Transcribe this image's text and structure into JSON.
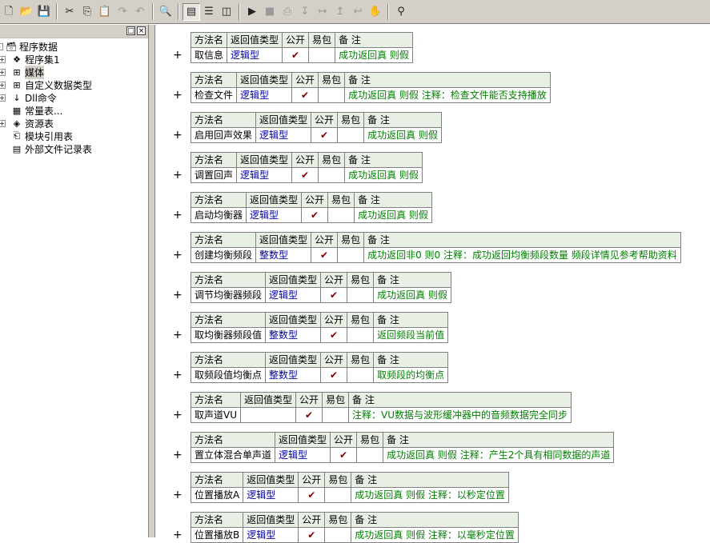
{
  "toolbar": {
    "buttons": [
      {
        "icon": "new-file-icon",
        "glyph": "🗋"
      },
      {
        "icon": "open-folder-icon",
        "glyph": "📂"
      },
      {
        "icon": "save-icon",
        "glyph": "💾"
      },
      {
        "sep": true
      },
      {
        "icon": "cut-icon",
        "glyph": "✂"
      },
      {
        "icon": "copy-icon",
        "glyph": "⎘"
      },
      {
        "icon": "paste-icon",
        "glyph": "📋"
      },
      {
        "icon": "redo-icon",
        "glyph": "↷",
        "disabled": true
      },
      {
        "icon": "undo-icon",
        "glyph": "↶",
        "disabled": true
      },
      {
        "sep": true
      },
      {
        "icon": "find-icon",
        "glyph": "🔍"
      },
      {
        "sep": true
      },
      {
        "icon": "layout-view-icon",
        "glyph": "▤",
        "pressed": true
      },
      {
        "icon": "split-horizontal-icon",
        "glyph": "☰"
      },
      {
        "icon": "split-vertical-icon",
        "glyph": "◫"
      },
      {
        "sep": true
      },
      {
        "icon": "run-icon",
        "glyph": "▶"
      },
      {
        "icon": "stop-icon",
        "glyph": "■",
        "disabled": true
      },
      {
        "icon": "step-compile-icon",
        "glyph": "⎙",
        "disabled": true
      },
      {
        "icon": "step-into-icon",
        "glyph": "↧",
        "disabled": true
      },
      {
        "icon": "step-over-icon",
        "glyph": "↦",
        "disabled": true
      },
      {
        "icon": "step-out-icon",
        "glyph": "↥",
        "disabled": true
      },
      {
        "icon": "run-to-cursor-icon",
        "glyph": "↩",
        "disabled": true
      },
      {
        "icon": "breakpoint-hand-icon",
        "glyph": "✋",
        "disabled": true
      },
      {
        "sep": true
      },
      {
        "icon": "binoculars-icon",
        "glyph": "⚲"
      }
    ]
  },
  "panel": {
    "pin_glyph": "□",
    "close_glyph": "×"
  },
  "tree": [
    {
      "label": "程序数据",
      "icon": "program-data-icon",
      "glyph": "🗃",
      "indent": 0,
      "box": "-"
    },
    {
      "label": "程序集1",
      "icon": "assembly-icon",
      "glyph": "❖",
      "indent": 1,
      "box": "+"
    },
    {
      "label": "媒体",
      "icon": "class-icon",
      "glyph": "⊞",
      "indent": 1,
      "box": "+",
      "selected": true
    },
    {
      "label": "自定义数据类型",
      "icon": "custom-type-icon",
      "glyph": "⊞",
      "indent": 1,
      "box": "+"
    },
    {
      "label": "Dll命令",
      "icon": "dll-command-icon",
      "glyph": "↓",
      "indent": 1,
      "box": "+"
    },
    {
      "label": "常量表...",
      "icon": "constant-table-icon",
      "glyph": "▦",
      "indent": 1,
      "box": ""
    },
    {
      "label": "资源表",
      "icon": "resource-table-icon",
      "glyph": "◈",
      "indent": 1,
      "box": "+"
    },
    {
      "label": "模块引用表",
      "icon": "module-ref-icon",
      "glyph": "⎗",
      "indent": 1,
      "box": ""
    },
    {
      "label": "外部文件记录表",
      "icon": "external-file-icon",
      "glyph": "▤",
      "indent": 1,
      "box": ""
    }
  ],
  "method_headers": {
    "name": "方法名",
    "return_type": "返回值类型",
    "public": "公开",
    "easy_pkg": "易包",
    "remark": "备 注"
  },
  "plus_glyph": "+",
  "check_glyph": "✔",
  "methods": [
    {
      "name": "取信息",
      "return_type": "逻辑型",
      "public": true,
      "remark": "成功返回真  则假"
    },
    {
      "name": "检查文件",
      "return_type": "逻辑型",
      "public": true,
      "remark": "成功返回真 则假  注释：检查文件能否支持播放"
    },
    {
      "name": "启用回声效果",
      "return_type": "逻辑型",
      "public": true,
      "remark": "成功返回真  则假"
    },
    {
      "name": "调置回声",
      "return_type": "逻辑型",
      "public": true,
      "remark": "成功返回真  则假"
    },
    {
      "name": "启动均衡器",
      "return_type": "逻辑型",
      "public": true,
      "remark": "成功返回真  则假"
    },
    {
      "name": "创建均衡频段",
      "return_type": "整数型",
      "public": true,
      "remark": "成功返回非0 则0  注释：成功返回均衡频段数量 频段详情见参考帮助资料"
    },
    {
      "name": "调节均衡器频段",
      "return_type": "逻辑型",
      "public": true,
      "remark": "成功返回真  则假"
    },
    {
      "name": "取均衡器频段值",
      "return_type": "整数型",
      "public": true,
      "remark": "返回频段当前值"
    },
    {
      "name": "取频段值均衡点",
      "return_type": "整数型",
      "public": true,
      "remark": "取频段的均衡点"
    },
    {
      "name": "取声道VU",
      "return_type": "",
      "public": true,
      "remark": "注释：VU数据与波形缓冲器中的音频数据完全同步"
    },
    {
      "name": "置立体混合单声道",
      "return_type": "逻辑型",
      "public": true,
      "remark": "成功返回真  则假  注释：产生2个具有相同数据的声道"
    },
    {
      "name": "位置播放A",
      "return_type": "逻辑型",
      "public": true,
      "remark": "成功返回真 则假   注释：以秒定位置"
    },
    {
      "name": "位置播放B",
      "return_type": "逻辑型",
      "public": true,
      "remark": "成功返回真 则假   注释：以毫秒定位置"
    }
  ]
}
